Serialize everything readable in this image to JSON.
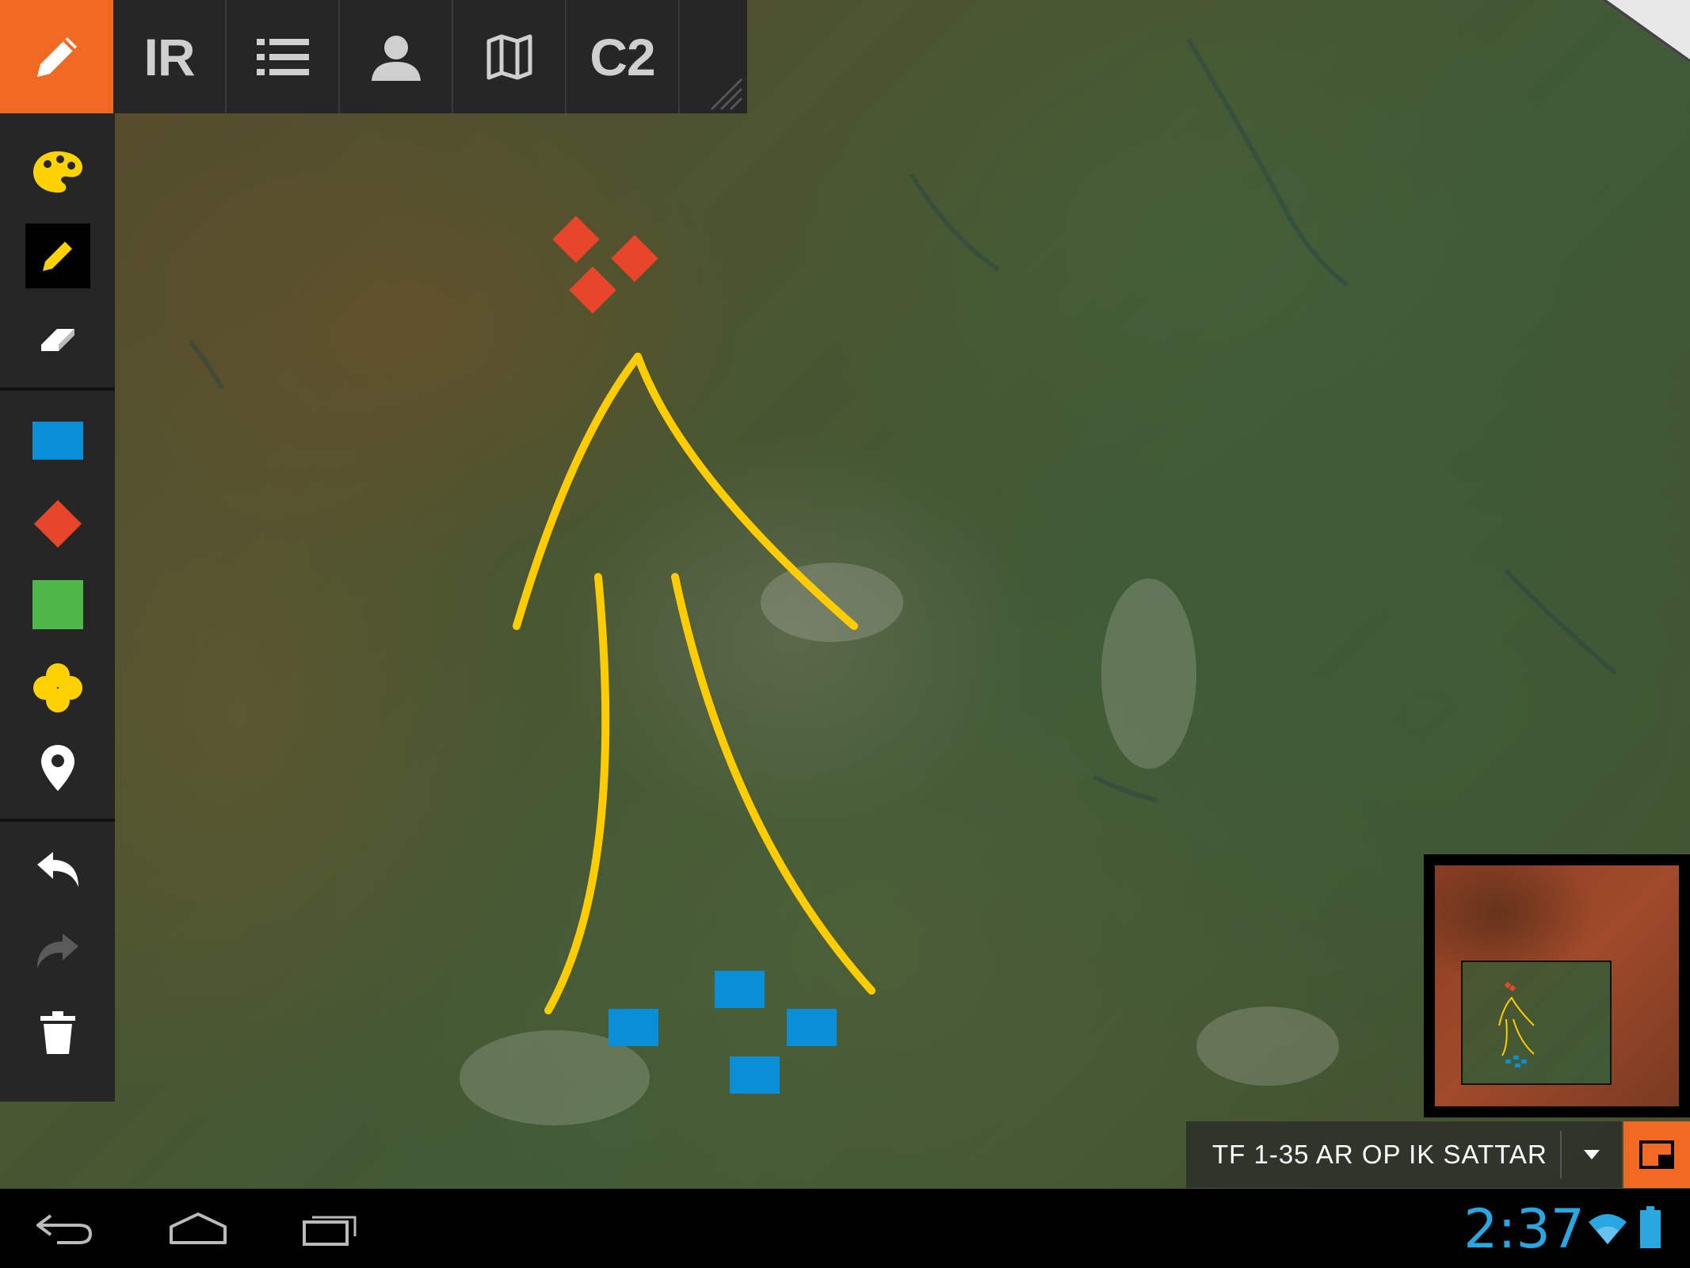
{
  "toolbar": {
    "tabs": [
      {
        "id": "draw",
        "icon": "pencil-icon",
        "active": true
      },
      {
        "id": "ir",
        "label": "IR"
      },
      {
        "id": "list",
        "icon": "list-icon"
      },
      {
        "id": "person",
        "icon": "person-icon"
      },
      {
        "id": "map",
        "icon": "map-icon"
      },
      {
        "id": "c2",
        "label": "C2"
      }
    ]
  },
  "sidebar": {
    "tools": [
      {
        "name": "palette",
        "icon": "palette-icon"
      },
      {
        "name": "pencil",
        "icon": "pencil-icon",
        "selected": true
      },
      {
        "name": "eraser",
        "icon": "eraser-icon"
      },
      {
        "name": "blue-rectangle",
        "icon": "blue-rectangle-icon",
        "color": "#0a8fd6"
      },
      {
        "name": "red-diamond",
        "icon": "red-diamond-icon",
        "color": "#e8462a"
      },
      {
        "name": "green-square",
        "icon": "green-square-icon",
        "color": "#4db848"
      },
      {
        "name": "yellow-clover",
        "icon": "yellow-clover-icon",
        "color": "#ffd200"
      },
      {
        "name": "map-pin",
        "icon": "map-pin-icon"
      },
      {
        "name": "undo",
        "icon": "undo-icon"
      },
      {
        "name": "redo",
        "icon": "redo-icon",
        "disabled": true
      },
      {
        "name": "delete",
        "icon": "trash-icon"
      }
    ]
  },
  "layer_selector": {
    "value": "TF 1-35 AR OP IK SATTAR"
  },
  "status_bar": {
    "time": "2:37"
  },
  "colors": {
    "accent": "#f26a21",
    "toolbar_bg": "#262626",
    "annotation_yellow": "#ffcc00",
    "enemy_red": "#e8462a",
    "friendly_blue": "#0a8fd6",
    "clock_blue": "#2aa7e0"
  }
}
